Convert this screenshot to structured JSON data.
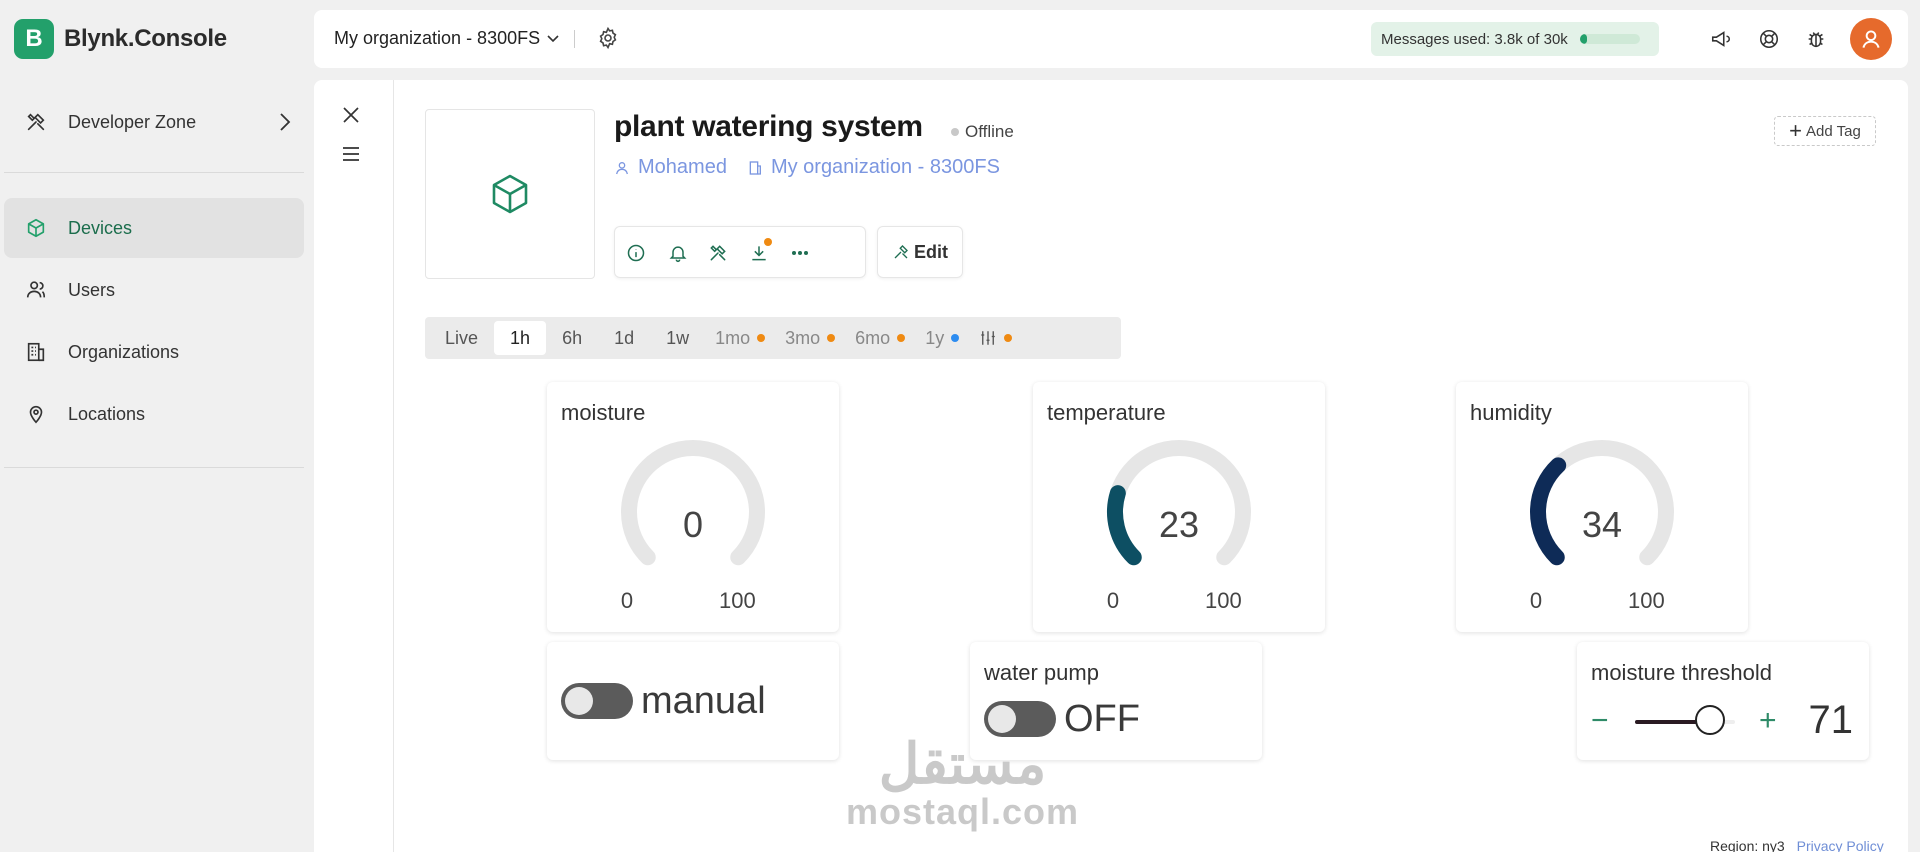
{
  "app": {
    "name": "Blynk.Console",
    "logo_letter": "B",
    "accent": "#23a06b"
  },
  "sidebar": {
    "developer_zone": "Developer Zone",
    "items": [
      {
        "label": "Devices",
        "icon": "cube-icon",
        "active": true
      },
      {
        "label": "Users",
        "icon": "users-icon"
      },
      {
        "label": "Organizations",
        "icon": "building-icon"
      },
      {
        "label": "Locations",
        "icon": "location-pin-icon"
      }
    ]
  },
  "header": {
    "org": "My organization - 8300FS",
    "messages_label": "Messages used:",
    "messages_value": "3.8k of 30k",
    "messages_fraction": 0.127
  },
  "device": {
    "name": "plant watering system",
    "status": "Offline",
    "owner": "Mohamed",
    "org": "My organization - 8300FS",
    "add_tag": "Add Tag",
    "edit": "Edit"
  },
  "time_tabs": [
    {
      "label": "Live"
    },
    {
      "label": "1h",
      "selected": true
    },
    {
      "label": "6h"
    },
    {
      "label": "1d"
    },
    {
      "label": "1w"
    },
    {
      "label": "1mo",
      "dot": "#ef8a12",
      "dim": true
    },
    {
      "label": "3mo",
      "dot": "#ef8a12",
      "dim": true
    },
    {
      "label": "6mo",
      "dot": "#ef8a12",
      "dim": true
    },
    {
      "label": "1y",
      "dot": "#2d8cf0",
      "dim": true
    }
  ],
  "widgets": {
    "moisture": {
      "title": "moisture",
      "value": "0",
      "min": "0",
      "max": "100",
      "fraction": 0.0,
      "color": "#0d4f63"
    },
    "temperature": {
      "title": "temperature",
      "value": "23",
      "min": "0",
      "max": "100",
      "fraction": 0.23,
      "color": "#0d4f63"
    },
    "humidity": {
      "title": "humidity",
      "value": "34",
      "min": "0",
      "max": "100",
      "fraction": 0.34,
      "color": "#0e2b57"
    },
    "manual": {
      "label": "manual"
    },
    "water_pump": {
      "title": "water pump",
      "state": "OFF"
    },
    "threshold": {
      "title": "moisture threshold",
      "value": "71",
      "fraction": 0.71,
      "minus": "−",
      "plus": "+"
    }
  },
  "watermark": {
    "arabic": "مستقل",
    "latin": "mostaql.com"
  },
  "footer": {
    "region": "Region: ny3",
    "privacy": "Privacy Policy"
  }
}
